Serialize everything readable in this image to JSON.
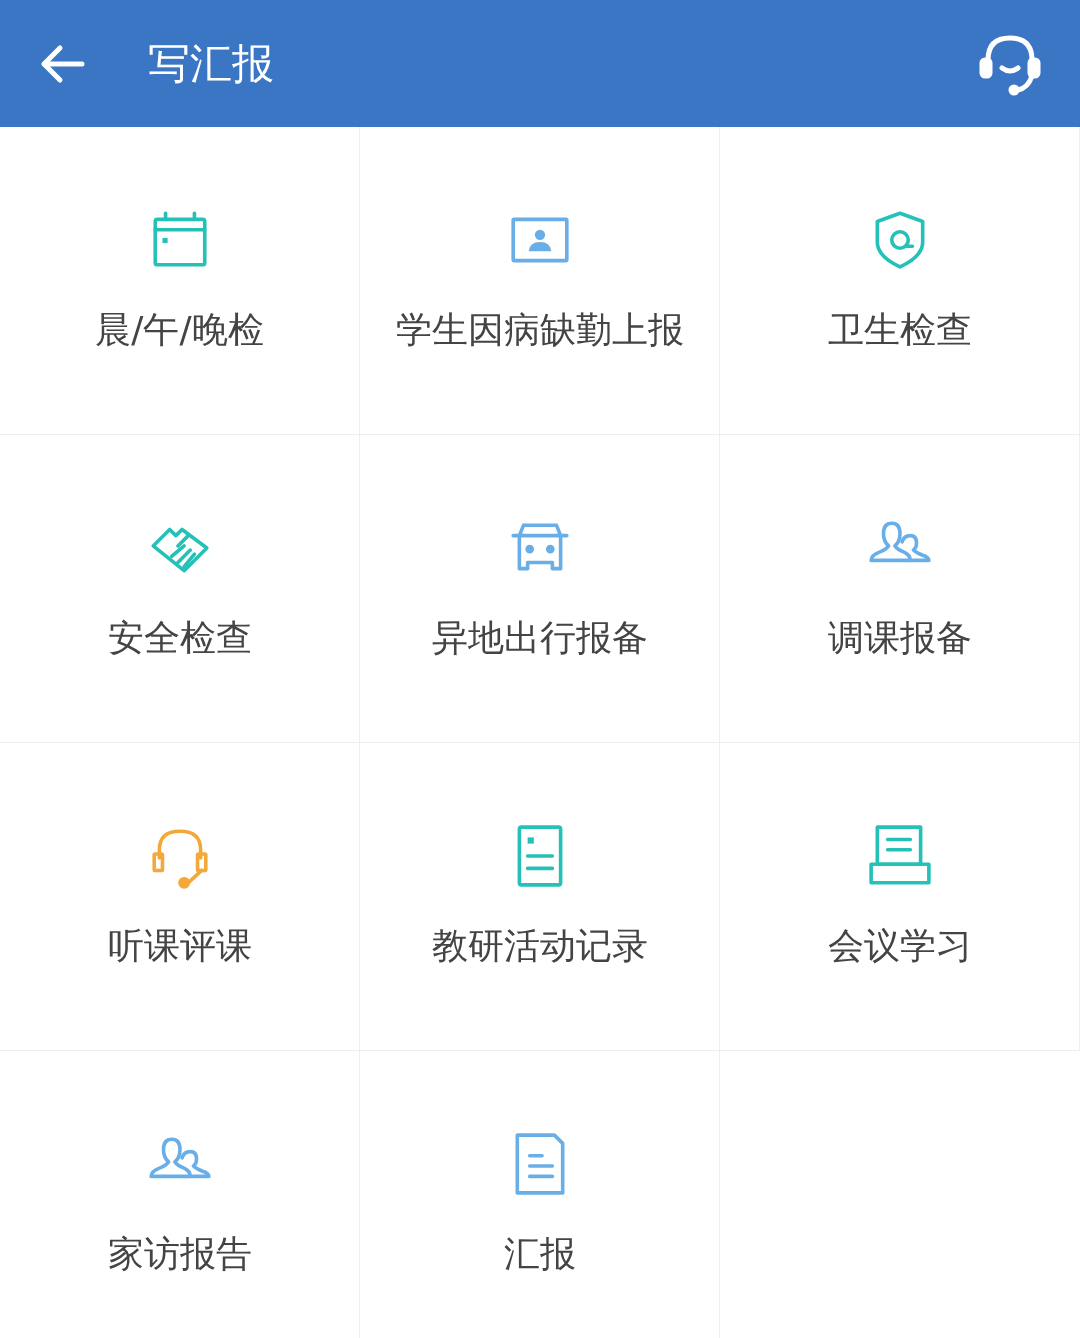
{
  "header": {
    "title": "写汇报"
  },
  "tiles": [
    {
      "label": "晨/午/晚检",
      "kind": "calendar",
      "color": "#25c1b8"
    },
    {
      "label": "学生因病缺勤上报",
      "kind": "portrait",
      "color": "#6aaee8"
    },
    {
      "label": "卫生检查",
      "kind": "shield",
      "color": "#25c1b8"
    },
    {
      "label": "安全检查",
      "kind": "handshake",
      "color": "#25c1b8"
    },
    {
      "label": "异地出行报备",
      "kind": "car",
      "color": "#6aaee8"
    },
    {
      "label": "调课报备",
      "kind": "people",
      "color": "#6aaee8"
    },
    {
      "label": "听课评课",
      "kind": "headset",
      "color": "#f3a93a"
    },
    {
      "label": "教研活动记录",
      "kind": "document",
      "color": "#25c1b8"
    },
    {
      "label": "会议学习",
      "kind": "printer",
      "color": "#25c1b8"
    },
    {
      "label": "家访报告",
      "kind": "people",
      "color": "#6aaee8"
    },
    {
      "label": "汇报",
      "kind": "file",
      "color": "#6aaee8"
    }
  ]
}
